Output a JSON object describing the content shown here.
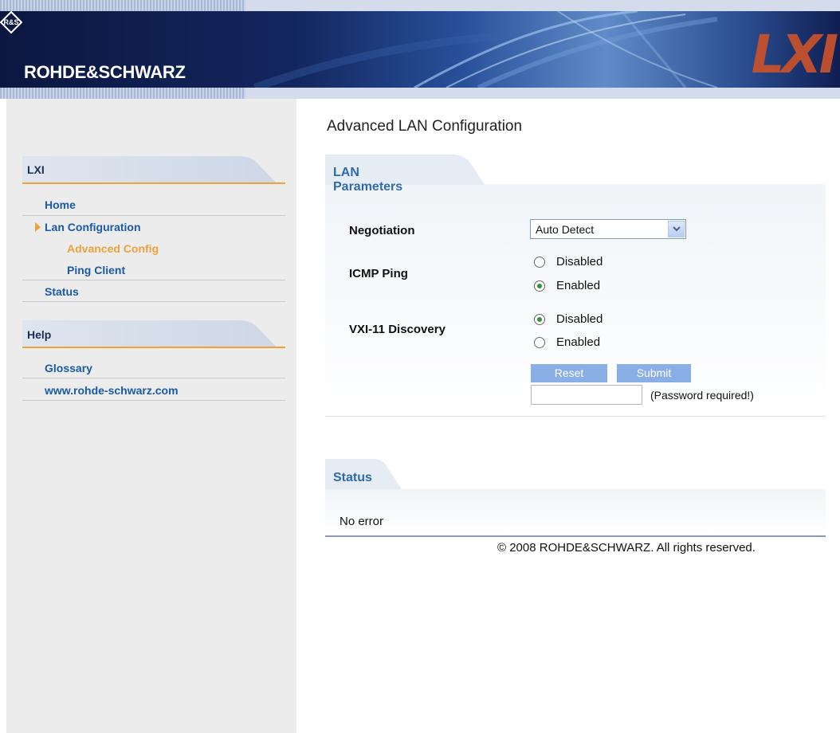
{
  "header": {
    "brand": "ROHDE&SCHWARZ",
    "logo_mark": "R&S",
    "lxi_logo": "LXI"
  },
  "sidebar": {
    "sections": [
      {
        "title": "LXI",
        "items": [
          {
            "label": "Home"
          },
          {
            "label": "Lan Configuration",
            "active": true
          },
          {
            "label": "Advanced Config",
            "sub": true,
            "current": true
          },
          {
            "label": "Ping Client",
            "sub": true
          },
          {
            "label": "Status"
          }
        ]
      },
      {
        "title": "Help",
        "items": [
          {
            "label": "Glossary"
          },
          {
            "label": "www.rohde-schwarz.com"
          }
        ]
      }
    ]
  },
  "main": {
    "title": "Advanced LAN Configuration",
    "lan_panel": {
      "title": "LAN Parameters",
      "negotiation": {
        "label": "Negotiation",
        "value": "Auto Detect"
      },
      "icmp_ping": {
        "label": "ICMP Ping",
        "options": [
          "Disabled",
          "Enabled"
        ],
        "selected": "Enabled"
      },
      "vxi11": {
        "label": "VXI-11 Discovery",
        "options": [
          "Disabled",
          "Enabled"
        ],
        "selected": "Disabled"
      },
      "reset_label": "Reset",
      "submit_label": "Submit",
      "password_note": "(Password required!)",
      "password_value": ""
    },
    "status_panel": {
      "title": "Status",
      "message": "No error"
    },
    "copyright": "© 2008 ROHDE&SCHWARZ. All rights reserved."
  },
  "colors": {
    "accent": "#f0a23a",
    "link": "#1a5aa6",
    "panel_title": "#2e6aaf",
    "button": "#8aaee6"
  }
}
